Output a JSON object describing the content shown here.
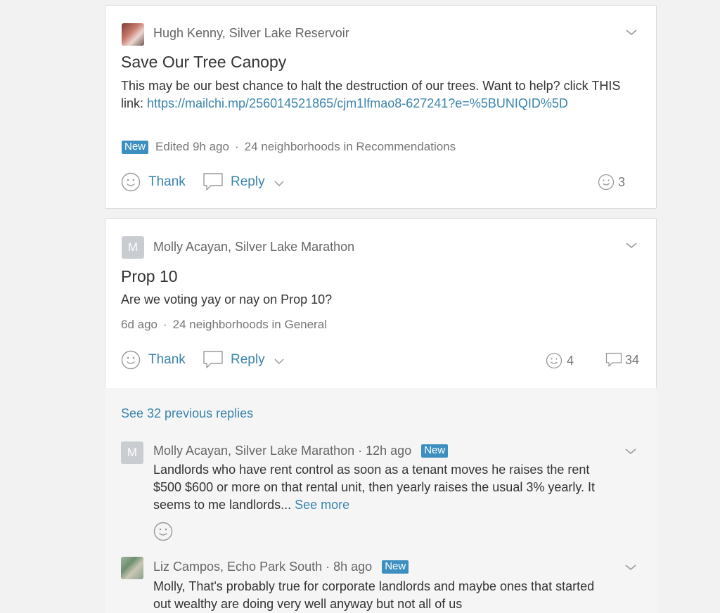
{
  "posts": [
    {
      "author": "Hugh Kenny, Silver Lake Reservoir",
      "title": "Save Our Tree Canopy",
      "body_text": "This may be our best chance to halt the destruction of our trees. Want to help? click THIS link: ",
      "link_text": "https://mailchi.mp/256014521865/cjm1lfmao8-627241?e=%5BUNIQID%5D",
      "badge": "New",
      "time": "Edited 9h ago",
      "audience": "24 neighborhoods in Recommendations",
      "thank_label": "Thank",
      "reply_label": "Reply",
      "thanks_count": "3"
    },
    {
      "author": "Molly Acayan, Silver Lake Marathon",
      "avatar_letter": "M",
      "title": "Prop 10",
      "body_text": "Are we voting yay or nay on Prop 10?",
      "time": "6d ago",
      "audience": "24 neighborhoods in General",
      "thank_label": "Thank",
      "reply_label": "Reply",
      "thanks_count": "4",
      "replies_count": "34"
    }
  ],
  "separator": "·",
  "see_previous_replies": "See 32 previous replies",
  "replies": [
    {
      "author": "Molly Acayan, Silver Lake Marathon",
      "avatar_letter": "M",
      "time": "12h ago",
      "badge": "New",
      "text": "Landlords who have rent control as soon as a tenant moves he raises the rent $500 $600 or more on that rental unit, then yearly raises the usual 3% yearly. It seems to me landlords...",
      "see_more": "See more"
    },
    {
      "author": "Liz Campos, Echo Park South",
      "time": "8h ago",
      "badge": "New",
      "text": "Molly, That's probably true for corporate landlords and maybe ones that started out wealthy are doing very well anyway but not all of us"
    }
  ],
  "colors": {
    "link": "#3a84ad",
    "badge": "#3d8fbf",
    "background": "#f2f2f2"
  }
}
